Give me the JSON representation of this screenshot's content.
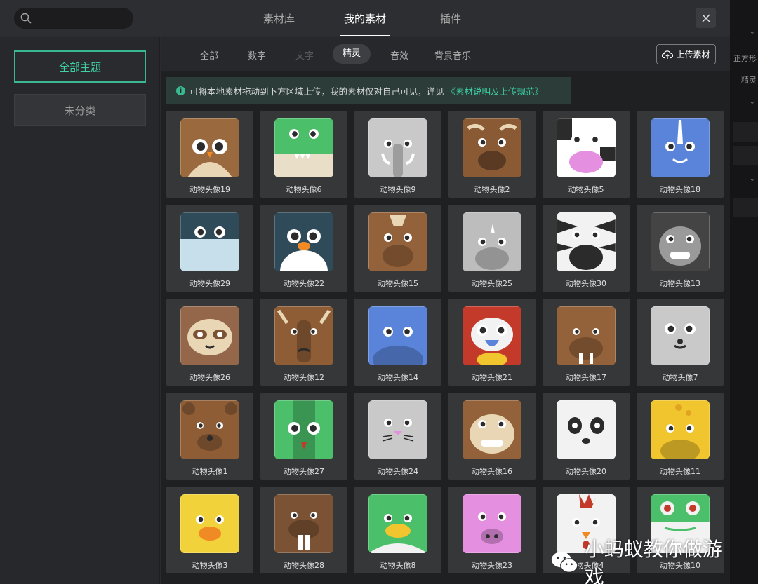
{
  "header": {
    "search_placeholder": "",
    "tabs": [
      {
        "label": "素材库",
        "active": false
      },
      {
        "label": "我的素材",
        "active": true
      },
      {
        "label": "插件",
        "active": false
      }
    ],
    "close_icon": "close-icon"
  },
  "sidebar": {
    "items": [
      {
        "label": "全部主题",
        "active": true
      },
      {
        "label": "未分类",
        "active": false
      }
    ]
  },
  "subtabs": [
    {
      "label": "全部",
      "state": "normal"
    },
    {
      "label": "数字",
      "state": "normal"
    },
    {
      "label": "文字",
      "state": "disabled"
    },
    {
      "label": "精灵",
      "state": "active"
    },
    {
      "label": "音效",
      "state": "normal"
    },
    {
      "label": "背景音乐",
      "state": "normal"
    }
  ],
  "upload": {
    "label": "上传素材",
    "icon": "cloud-upload-icon"
  },
  "notice": {
    "text": "可将本地素材拖动到下方区域上传，我的素材仅对自己可见，详见",
    "link": "《素材说明及上传规范》",
    "icon": "info-icon"
  },
  "assets": [
    {
      "name": "动物头像19",
      "animal": "owl",
      "color": "#9a6a3e"
    },
    {
      "name": "动物头像6",
      "animal": "crocodile",
      "color": "#4cbf6a"
    },
    {
      "name": "动物头像9",
      "animal": "elephant",
      "color": "#c9c9c9"
    },
    {
      "name": "动物头像2",
      "animal": "buffalo",
      "color": "#8a5a34"
    },
    {
      "name": "动物头像5",
      "animal": "cow",
      "color": "#ffffff"
    },
    {
      "name": "动物头像18",
      "animal": "narwhal",
      "color": "#5a84d9"
    },
    {
      "name": "动物头像29",
      "animal": "whale",
      "color": "#2f4a58"
    },
    {
      "name": "动物头像22",
      "animal": "penguin",
      "color": "#2f4a58"
    },
    {
      "name": "动物头像15",
      "animal": "horse",
      "color": "#93623a"
    },
    {
      "name": "动物头像25",
      "animal": "rhino",
      "color": "#bdbdbd"
    },
    {
      "name": "动物头像30",
      "animal": "zebra",
      "color": "#f2f2f2"
    },
    {
      "name": "动物头像13",
      "animal": "gorilla",
      "color": "#444444"
    },
    {
      "name": "动物头像26",
      "animal": "sloth",
      "color": "#94664a"
    },
    {
      "name": "动物头像12",
      "animal": "moose",
      "color": "#8e5d36"
    },
    {
      "name": "动物头像14",
      "animal": "hippo",
      "color": "#5a84d9"
    },
    {
      "name": "动物头像21",
      "animal": "parrot",
      "color": "#c43a2a"
    },
    {
      "name": "动物头像17",
      "animal": "walrus",
      "color": "#93623a"
    },
    {
      "name": "动物头像7",
      "animal": "seal",
      "color": "#c9c9c9"
    },
    {
      "name": "动物头像1",
      "animal": "bear",
      "color": "#8e5d36"
    },
    {
      "name": "动物头像27",
      "animal": "snake",
      "color": "#4cbf6a"
    },
    {
      "name": "动物头像24",
      "animal": "rabbit",
      "color": "#c9c9c9"
    },
    {
      "name": "动物头像16",
      "animal": "monkey",
      "color": "#93623a"
    },
    {
      "name": "动物头像20",
      "animal": "panda",
      "color": "#f2f2f2"
    },
    {
      "name": "动物头像11",
      "animal": "giraffe",
      "color": "#f1c52d"
    },
    {
      "name": "动物头像3",
      "animal": "chick",
      "color": "#f1d23a"
    },
    {
      "name": "动物头像28",
      "animal": "beaver",
      "color": "#7b5233"
    },
    {
      "name": "动物头像8",
      "animal": "duck",
      "color": "#4cbf6a"
    },
    {
      "name": "动物头像23",
      "animal": "pig",
      "color": "#e58fe0"
    },
    {
      "name": "动物头像4",
      "animal": "chicken",
      "color": "#f2f2f2"
    },
    {
      "name": "动物头像10",
      "animal": "frog",
      "color": "#4cbf6a"
    }
  ],
  "background_panel": {
    "labels": [
      "正方形",
      "精灵"
    ]
  },
  "watermark": {
    "text": "小蚂蚁教你做游戏",
    "icon": "wechat-icon"
  },
  "colors": {
    "accent": "#3ab892",
    "modal_bg": "#2a2b2e",
    "card_bg": "#363739"
  }
}
